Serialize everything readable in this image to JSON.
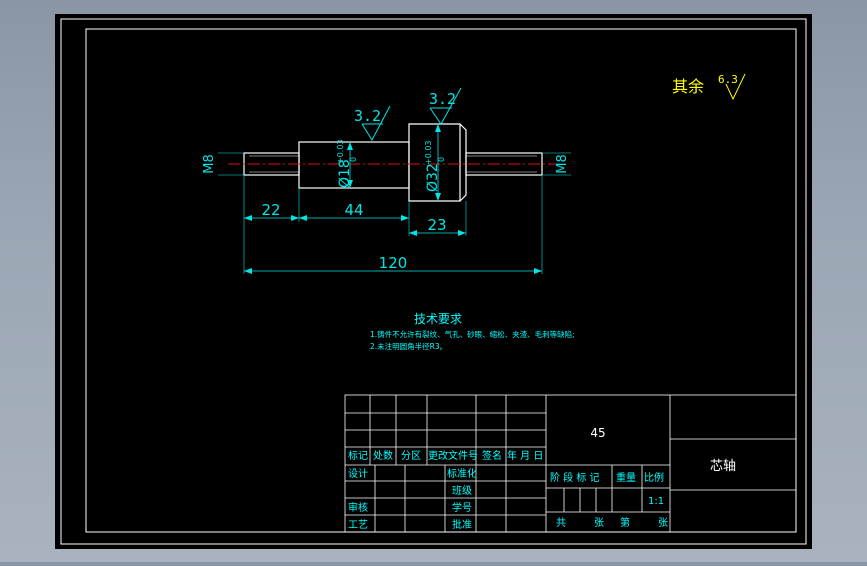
{
  "colors": {
    "canvas": "#000000",
    "outline": "#ffffff",
    "dimension": "#00e5e5",
    "centerline": "#e01010",
    "roughness_note": "#ffff00",
    "title_text": "#00ffff",
    "tech_text": "#00ffff"
  },
  "roughness_note": {
    "prefix": "其余",
    "value": "6.3"
  },
  "roughness_symbols": [
    {
      "value": "3.2"
    },
    {
      "value": "3.2"
    }
  ],
  "dimensions": {
    "left_thread": "M8",
    "right_thread": "M8",
    "dia_small": "Ø18",
    "dia_small_tol_upper": "+0.03",
    "dia_small_tol_lower": "0",
    "dia_large": "Ø32",
    "dia_large_tol_upper": "+0.03",
    "dia_large_tol_lower": "0",
    "len_left": "22",
    "len_mid": "44",
    "len_big": "23",
    "len_total": "120"
  },
  "tech_requirements": {
    "title": "技术要求",
    "items": [
      "1.铸件不允许有裂纹、气孔、砂眼、缩松、夹渣、毛刺等缺陷;",
      "2.未注明圆角半径R3。"
    ]
  },
  "title_block": {
    "material": "45",
    "part_name": "芯轴",
    "rev_headers": [
      "标记",
      "处数",
      "分区",
      "更改文件号",
      "签名",
      "年 月 日"
    ],
    "row_design": "设计",
    "row_standard": "标准化",
    "row_check": "审核",
    "row_process": "工艺",
    "row_approve": "批准",
    "row_class": "班级",
    "row_student_no": "学号",
    "stage_labels": [
      "阶 段 标 记",
      "重量",
      "比例"
    ],
    "scale": "1:1",
    "sheet_labels": [
      "共",
      "张",
      "第",
      "张"
    ]
  }
}
